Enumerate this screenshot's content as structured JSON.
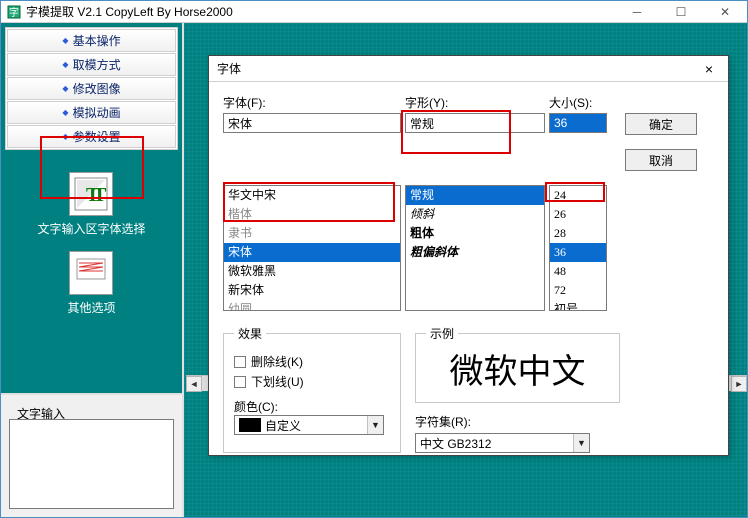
{
  "window": {
    "title": "字模提取 V2.1   CopyLeft By Horse2000"
  },
  "sidebar": {
    "items": [
      "基本操作",
      "取模方式",
      "修改图像",
      "模拟动画",
      "参数设置"
    ],
    "icon_labels": [
      "文字输入区字体选择",
      "其他选项"
    ]
  },
  "lower_panel": {
    "label": "文字输入"
  },
  "dialog": {
    "title": "字体",
    "close": "×",
    "labels": {
      "font": "字体(F):",
      "style": "字形(Y):",
      "size": "大小(S):",
      "effects": "效果",
      "strike": "删除线(K)",
      "underline": "下划线(U)",
      "color": "颜色(C):",
      "sample": "示例",
      "charset": "字符集(R):"
    },
    "buttons": {
      "ok": "确定",
      "cancel": "取消"
    },
    "font_value": "宋体",
    "font_list": [
      "华文中宋",
      "楷体",
      "隶书",
      "宋体",
      "微软雅黑",
      "新宋体",
      "幼圆"
    ],
    "font_selected": "宋体",
    "style_value": "常规",
    "style_list": [
      "常规",
      "倾斜",
      "粗体",
      "粗偏斜体"
    ],
    "style_selected": "常规",
    "size_value": "36",
    "size_list": [
      "24",
      "26",
      "28",
      "36",
      "48",
      "72",
      "初号"
    ],
    "size_selected": "36",
    "color_name": "自定义",
    "color_value": "#000000",
    "sample_text": "微软中文",
    "charset_value": "中文 GB2312"
  }
}
